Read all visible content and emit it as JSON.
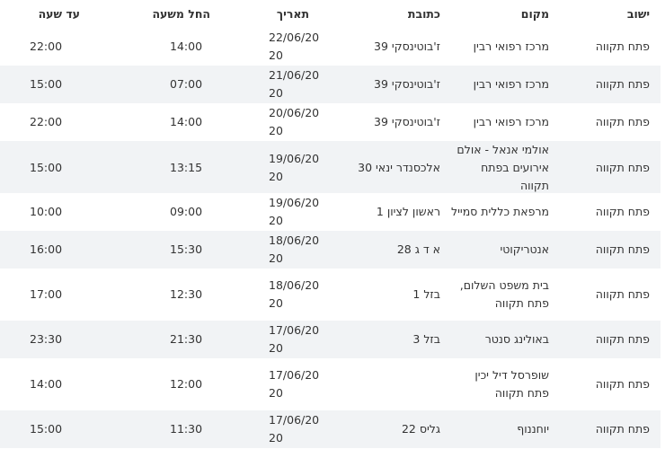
{
  "headers": {
    "city": "ישוב",
    "place": "מקום",
    "address": "כתובת",
    "date": "תאריך",
    "start": "החל משעה",
    "end": "עד שעה"
  },
  "rows": [
    {
      "city": "פתח תקווה",
      "place": "מרכז רפואי רבין",
      "address": "ז'בוטינסקי 39",
      "date": "22/06/2020",
      "start": "14:00",
      "end": "22:00"
    },
    {
      "city": "פתח תקווה",
      "place": "מרכז רפואי רבין",
      "address": "ז'בוטינסקי 39",
      "date": "21/06/2020",
      "start": "07:00",
      "end": "15:00"
    },
    {
      "city": "פתח תקווה",
      "place": "מרכז רפואי רבין",
      "address": "ז'בוטינסקי 39",
      "date": "20/06/2020",
      "start": "14:00",
      "end": "22:00"
    },
    {
      "city": "פתח תקווה",
      "place": "אולמי אנאל - אולם אירועים בפתח תקווה",
      "address": "אלכסנדר ינאי 30",
      "date": "19/06/2020",
      "start": "13:15",
      "end": "15:00"
    },
    {
      "city": "פתח תקווה",
      "place": "מרפאת כללית סמייל",
      "address": "ראשון לציון 1",
      "date": "19/06/2020",
      "start": "09:00",
      "end": "10:00"
    },
    {
      "city": "פתח תקווה",
      "place": "אנטריקוטי",
      "address": "א ד ג 28",
      "date": "18/06/2020",
      "start": "15:30",
      "end": "16:00"
    },
    {
      "city": "פתח תקווה",
      "place": "בית משפט השלום, פתח תקווה",
      "address": "בזל 1",
      "date": "18/06/2020",
      "start": "12:30",
      "end": "17:00"
    },
    {
      "city": "פתח תקווה",
      "place": "באולינג סנטר",
      "address": "בזל 3",
      "date": "17/06/2020",
      "start": "21:30",
      "end": "23:30"
    },
    {
      "city": "פתח תקווה",
      "place": "שופרסל דיל יכין פתח תקווה",
      "address": "",
      "date": "17/06/2020",
      "start": "12:00",
      "end": "14:00"
    },
    {
      "city": "פתח תקווה",
      "place": "יוחננוף",
      "address": "גליס 22",
      "date": "17/06/2020",
      "start": "11:30",
      "end": "15:00"
    }
  ]
}
